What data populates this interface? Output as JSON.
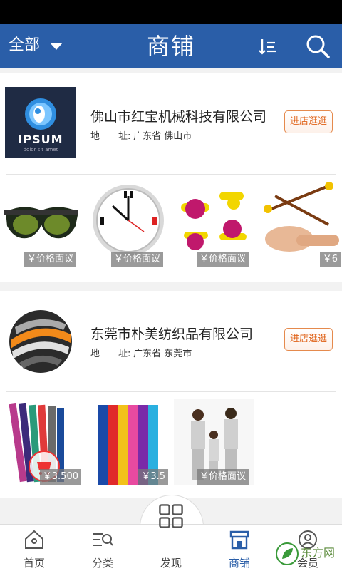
{
  "header": {
    "filter_label": "全部",
    "title": "商铺"
  },
  "shops": [
    {
      "name": "佛山市红宝机械科技有限公司",
      "addr_label": "地　　址:",
      "addr_value": "广东省 佛山市",
      "enter_label": "进店逛逛",
      "products": [
        {
          "price": "￥价格面议"
        },
        {
          "price": "￥价格面议"
        },
        {
          "price": "￥价格面议"
        },
        {
          "price": "￥6"
        }
      ]
    },
    {
      "name": "东莞市朴美纺织品有限公司",
      "addr_label": "地　　址:",
      "addr_value": "广东省 东莞市",
      "enter_label": "进店逛逛",
      "products": [
        {
          "price": "￥3.500"
        },
        {
          "price": "￥3.5"
        },
        {
          "price": "￥价格面议"
        }
      ]
    }
  ],
  "tabs": [
    {
      "label": "首页"
    },
    {
      "label": "分类"
    },
    {
      "label": "发现"
    },
    {
      "label": "商铺"
    },
    {
      "label": "会员"
    }
  ],
  "logo1_text": {
    "line1": "IPSUM",
    "line2": "dolor sit amet"
  },
  "watermark": "东方网"
}
